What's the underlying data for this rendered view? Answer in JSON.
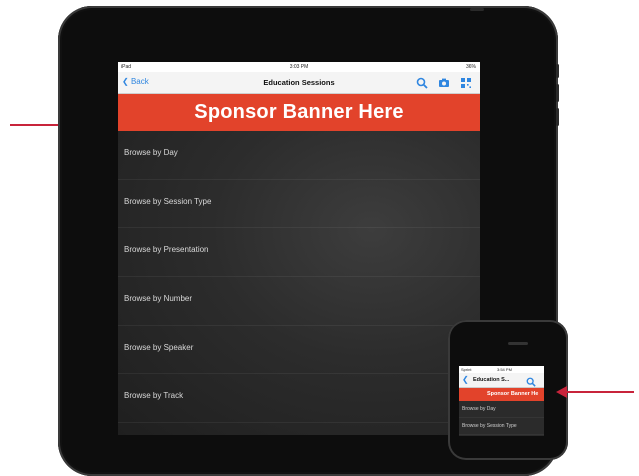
{
  "ipad": {
    "status": {
      "carrier": "iPad",
      "time": "3:03 PM",
      "battery": "36%"
    },
    "nav": {
      "back_label": "Back",
      "title": "Education Sessions"
    },
    "banner_text": "Sponsor Banner Here",
    "menu_items": [
      {
        "label": "Browse by Day"
      },
      {
        "label": "Browse by Session Type"
      },
      {
        "label": "Browse by Presentation"
      },
      {
        "label": "Browse by Number"
      },
      {
        "label": "Browse by Speaker"
      },
      {
        "label": "Browse by Track"
      }
    ]
  },
  "iphone": {
    "status": {
      "carrier": "Sprint",
      "time": "3:54 PM"
    },
    "nav": {
      "title": "Education S..."
    },
    "banner_text": "Sponsor Banner He",
    "menu_items": [
      {
        "label": "Browse by Day"
      },
      {
        "label": "Browse by Session Type"
      }
    ]
  },
  "colors": {
    "banner": "#e2432b",
    "accent_blue": "#2f86e0",
    "arrow": "#c8243b"
  },
  "icons": [
    "chevron-left-icon",
    "search-icon",
    "camera-icon",
    "qr-code-icon",
    "arrow-right-icon",
    "arrow-left-icon"
  ]
}
